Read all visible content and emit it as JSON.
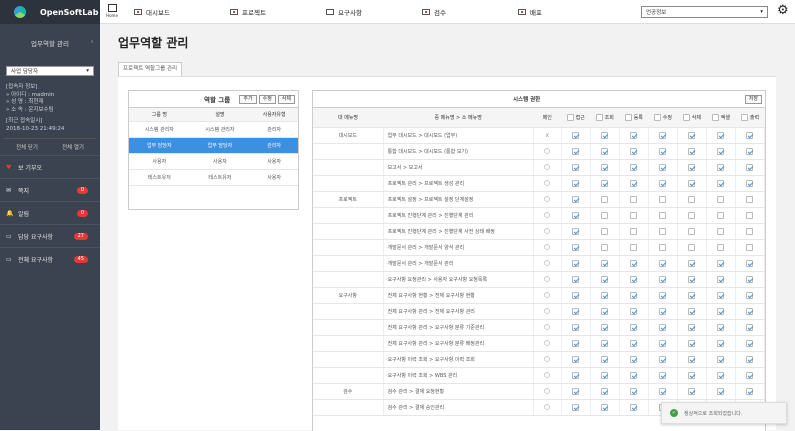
{
  "app": {
    "brand": "OpenSoftLab"
  },
  "sidebar": {
    "menu_title": "업무역할 관리",
    "role_select": "사업 담당자",
    "connect_info_title": "[접속자 정보]",
    "user_id": "» 아이디 : madmin",
    "user_name": "» 성    명 : 최현재",
    "user_dept": "» 소    속 : 운지보수팀",
    "last_login_title": "[최근 접속일시]",
    "last_login": "2018-10-23 21:49:24",
    "btn_close_all": "전체 닫기",
    "btn_open_all": "전체 열기",
    "items": [
      {
        "label": "보 기부오",
        "icon": "heart-icon",
        "badge": ""
      },
      {
        "label": "쪽지",
        "icon": "mail-icon",
        "badge": "0"
      },
      {
        "label": "알림",
        "icon": "bell-icon",
        "badge": "0"
      },
      {
        "label": "담당 요구사항",
        "icon": "monitor-icon",
        "badge": "27"
      },
      {
        "label": "전체 요구사항",
        "icon": "monitor-icon",
        "badge": "45"
      }
    ]
  },
  "topnav": {
    "home_label": "Home",
    "items": [
      "대시보드",
      "프로젝트",
      "요구사항",
      "검수",
      "배포"
    ],
    "lang": "언공정보"
  },
  "page": {
    "title": "업무역할 관리",
    "tab": "프로젝트 역할그룹 관리"
  },
  "roles": {
    "header": "역할 그룹",
    "btn_add": "추가",
    "btn_edit": "수정",
    "btn_delete": "삭제",
    "columns": [
      "그룹 명",
      "설명",
      "사용자유형"
    ],
    "rows": [
      {
        "name": "시스템 관리자",
        "desc": "시스템 관리자",
        "type": "관리자",
        "selected": false
      },
      {
        "name": "업무 담당자",
        "desc": "업무 담당자",
        "type": "관리자",
        "selected": true
      },
      {
        "name": "사용자",
        "desc": "사용자",
        "type": "사용자",
        "selected": false
      },
      {
        "name": "테스트유저",
        "desc": "테스트유저",
        "type": "사용자",
        "selected": false
      }
    ]
  },
  "perms": {
    "header": "시스템 권한",
    "btn_save": "저장",
    "columns": [
      "대 메뉴명",
      "중 메뉴명 > 소 메뉴명",
      "메인",
      "접근",
      "조회",
      "등록",
      "수정",
      "삭제",
      "엑셀",
      "출력"
    ],
    "rows": [
      {
        "major": "대시보드",
        "menu": "업무 대시보드 > 대시보드 (업무)",
        "main": "x",
        "checks": [
          1,
          1,
          1,
          1,
          1,
          1,
          1
        ]
      },
      {
        "major": "",
        "menu": "통합 대시보드 > 대시보드 (통합 보기)",
        "main": "",
        "checks": [
          1,
          1,
          1,
          1,
          1,
          1,
          1
        ]
      },
      {
        "major": "",
        "menu": "보고서 > 보고서",
        "main": "",
        "checks": [
          1,
          1,
          1,
          1,
          1,
          1,
          1
        ]
      },
      {
        "major": "",
        "menu": "프로젝트 관리 > 프로젝트 생성 관리",
        "main": "",
        "checks": [
          1,
          1,
          1,
          1,
          1,
          1,
          1
        ]
      },
      {
        "major": "프로젝트",
        "menu": "프로젝트 설정 > 프로젝트 설정 단계설정",
        "main": "",
        "checks": [
          1,
          0,
          0,
          0,
          0,
          0,
          0
        ]
      },
      {
        "major": "",
        "menu": "프로젝트 진행단계 관리 > 진행단계 관리",
        "main": "",
        "checks": [
          1,
          0,
          0,
          0,
          0,
          0,
          0
        ]
      },
      {
        "major": "",
        "menu": "프로젝트 진행단계 관리 > 진행단계 사전 상태 배정",
        "main": "",
        "checks": [
          1,
          0,
          0,
          0,
          0,
          0,
          0
        ]
      },
      {
        "major": "",
        "menu": "개발문서 관리 > 개발문서 양식 관리",
        "main": "",
        "checks": [
          1,
          0,
          0,
          0,
          0,
          0,
          0
        ]
      },
      {
        "major": "",
        "menu": "개발문서 관리 > 개발문서 관리",
        "main": "",
        "checks": [
          1,
          1,
          1,
          1,
          1,
          1,
          1
        ]
      },
      {
        "major": "",
        "menu": "요구사항 요청관리 > 사용자 요구사항 요청목록",
        "main": "",
        "checks": [
          1,
          1,
          1,
          1,
          1,
          1,
          1
        ]
      },
      {
        "major": "요구사항",
        "menu": "전체 요구사항 현황 > 전체 요구사항 현황",
        "main": "",
        "checks": [
          1,
          1,
          1,
          1,
          1,
          1,
          1
        ]
      },
      {
        "major": "",
        "menu": "전체 요구사항 관리 > 전체 요구사항 관리",
        "main": "",
        "checks": [
          1,
          1,
          1,
          1,
          1,
          1,
          1
        ]
      },
      {
        "major": "",
        "menu": "전체 요구사항 관리 > 요구사항 분류 기준관리",
        "main": "",
        "checks": [
          1,
          1,
          1,
          1,
          1,
          1,
          1
        ]
      },
      {
        "major": "",
        "menu": "전체 요구사항 관리 > 요구사항 분류 배정관리",
        "main": "",
        "checks": [
          1,
          1,
          1,
          1,
          1,
          1,
          1
        ]
      },
      {
        "major": "",
        "menu": "요구사항 이력 조회 > 요구사항 이력 조회",
        "main": "",
        "checks": [
          1,
          1,
          1,
          1,
          1,
          1,
          1
        ]
      },
      {
        "major": "",
        "menu": "요구사항 이력 조회 > WBS 관리",
        "main": "",
        "checks": [
          1,
          1,
          1,
          1,
          1,
          1,
          1
        ]
      },
      {
        "major": "검수",
        "menu": "검수 관리 > 결재 요청현황",
        "main": "",
        "checks": [
          1,
          1,
          1,
          1,
          1,
          1,
          1
        ]
      },
      {
        "major": "",
        "menu": "검수 관리 > 결재 승인관리",
        "main": "",
        "checks": [
          1,
          1,
          1,
          1,
          1,
          1,
          1
        ]
      }
    ]
  },
  "toast": {
    "message": "정상적으로 조회되었습니다."
  }
}
